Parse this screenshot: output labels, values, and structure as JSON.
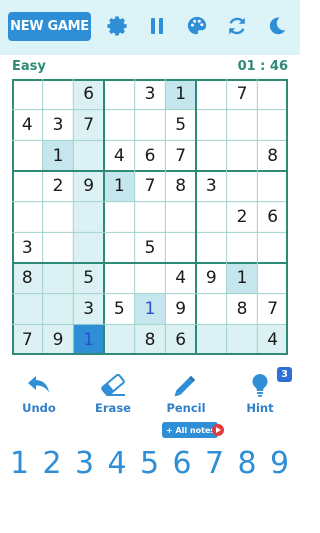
{
  "header": {
    "new_game_label": "NEW GAME",
    "icons": [
      "gear-icon",
      "pause-icon",
      "palette-icon",
      "refresh-icon",
      "moon-icon"
    ]
  },
  "status": {
    "difficulty": "Easy",
    "timer": "01 : 46"
  },
  "board": {
    "rows": [
      [
        "",
        "",
        "6",
        "",
        "3",
        "1",
        "",
        "7",
        ""
      ],
      [
        "4",
        "3",
        "7",
        "",
        "",
        "5",
        "",
        "",
        ""
      ],
      [
        "",
        "1",
        "",
        "4",
        "6",
        "7",
        "",
        "",
        "8"
      ],
      [
        "",
        "2",
        "9",
        "1",
        "7",
        "8",
        "3",
        "",
        ""
      ],
      [
        "",
        "",
        "",
        "",
        "",
        "",
        "",
        "2",
        "6"
      ],
      [
        "3",
        "",
        "",
        "",
        "5",
        "",
        "",
        "",
        ""
      ],
      [
        "8",
        "",
        "5",
        "",
        "",
        "4",
        "9",
        "1",
        ""
      ],
      [
        "",
        "",
        "3",
        "5",
        "1",
        "9",
        "",
        "8",
        "7"
      ],
      [
        "7",
        "9",
        "1",
        "",
        "8",
        "6",
        "",
        "",
        "4"
      ]
    ],
    "user_entered": [
      [
        7,
        4
      ],
      [
        8,
        2
      ]
    ],
    "selected": [
      8,
      2
    ],
    "same_number": [
      [
        0,
        5
      ],
      [
        2,
        1
      ],
      [
        3,
        3
      ],
      [
        6,
        7
      ],
      [
        7,
        4
      ]
    ],
    "colors": {
      "grid": "#2e8a77",
      "highlight": "#dcf1f3",
      "same": "#c5e6ec",
      "selected": "#2f8fd6"
    }
  },
  "tools": {
    "undo": "Undo",
    "erase": "Erase",
    "pencil": "Pencil",
    "hint": "Hint",
    "hint_count": "3",
    "all_notes": "+ All notes"
  },
  "numpad": [
    "1",
    "2",
    "3",
    "4",
    "5",
    "6",
    "7",
    "8",
    "9"
  ],
  "accent": "#2f8fd6"
}
